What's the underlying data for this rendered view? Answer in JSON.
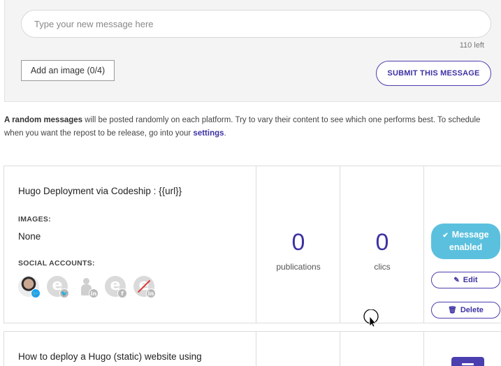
{
  "composer": {
    "input_placeholder": "Type your new message here",
    "input_value": "",
    "chars_left": "110 left",
    "add_image_label": "Add an image (0/4)",
    "submit_label": "SUBMIT THIS MESSAGE"
  },
  "info": {
    "bold": "A random messages",
    "text": " will be posted randomly on each platform. Try to vary their content to see which one performs best. To schedule when you want the repost to be release, go into your ",
    "link": "settings",
    "end": "."
  },
  "messages": [
    {
      "title": "Hugo Deployment via Codeship : {{url}}",
      "images_label": "IMAGES:",
      "images_value": "None",
      "social_label": "SOCIAL ACCOUNTS:",
      "accounts": [
        {
          "avatar": "photo",
          "network": "twitter-icon",
          "badge": "🐦"
        },
        {
          "avatar": "logo",
          "network": "twitter-icon",
          "badge": "🐦"
        },
        {
          "avatar": "person",
          "network": "linkedin-icon",
          "badge": "in"
        },
        {
          "avatar": "logo",
          "network": "facebook-icon",
          "badge": "f"
        },
        {
          "avatar": "logo-slashed",
          "network": "linkedin-icon",
          "badge": "in"
        }
      ],
      "publications": "0",
      "publications_label": "publications",
      "clics": "0",
      "clics_label": "clics",
      "enabled_label": "Message enabled",
      "edit_label": "Edit",
      "delete_label": "Delete"
    },
    {
      "title": "How to deploy a Hugo (static) website using"
    }
  ],
  "colors": {
    "accent": "#3d32a3",
    "enabled": "#5bc0de",
    "twitter": "#1da1f2"
  }
}
